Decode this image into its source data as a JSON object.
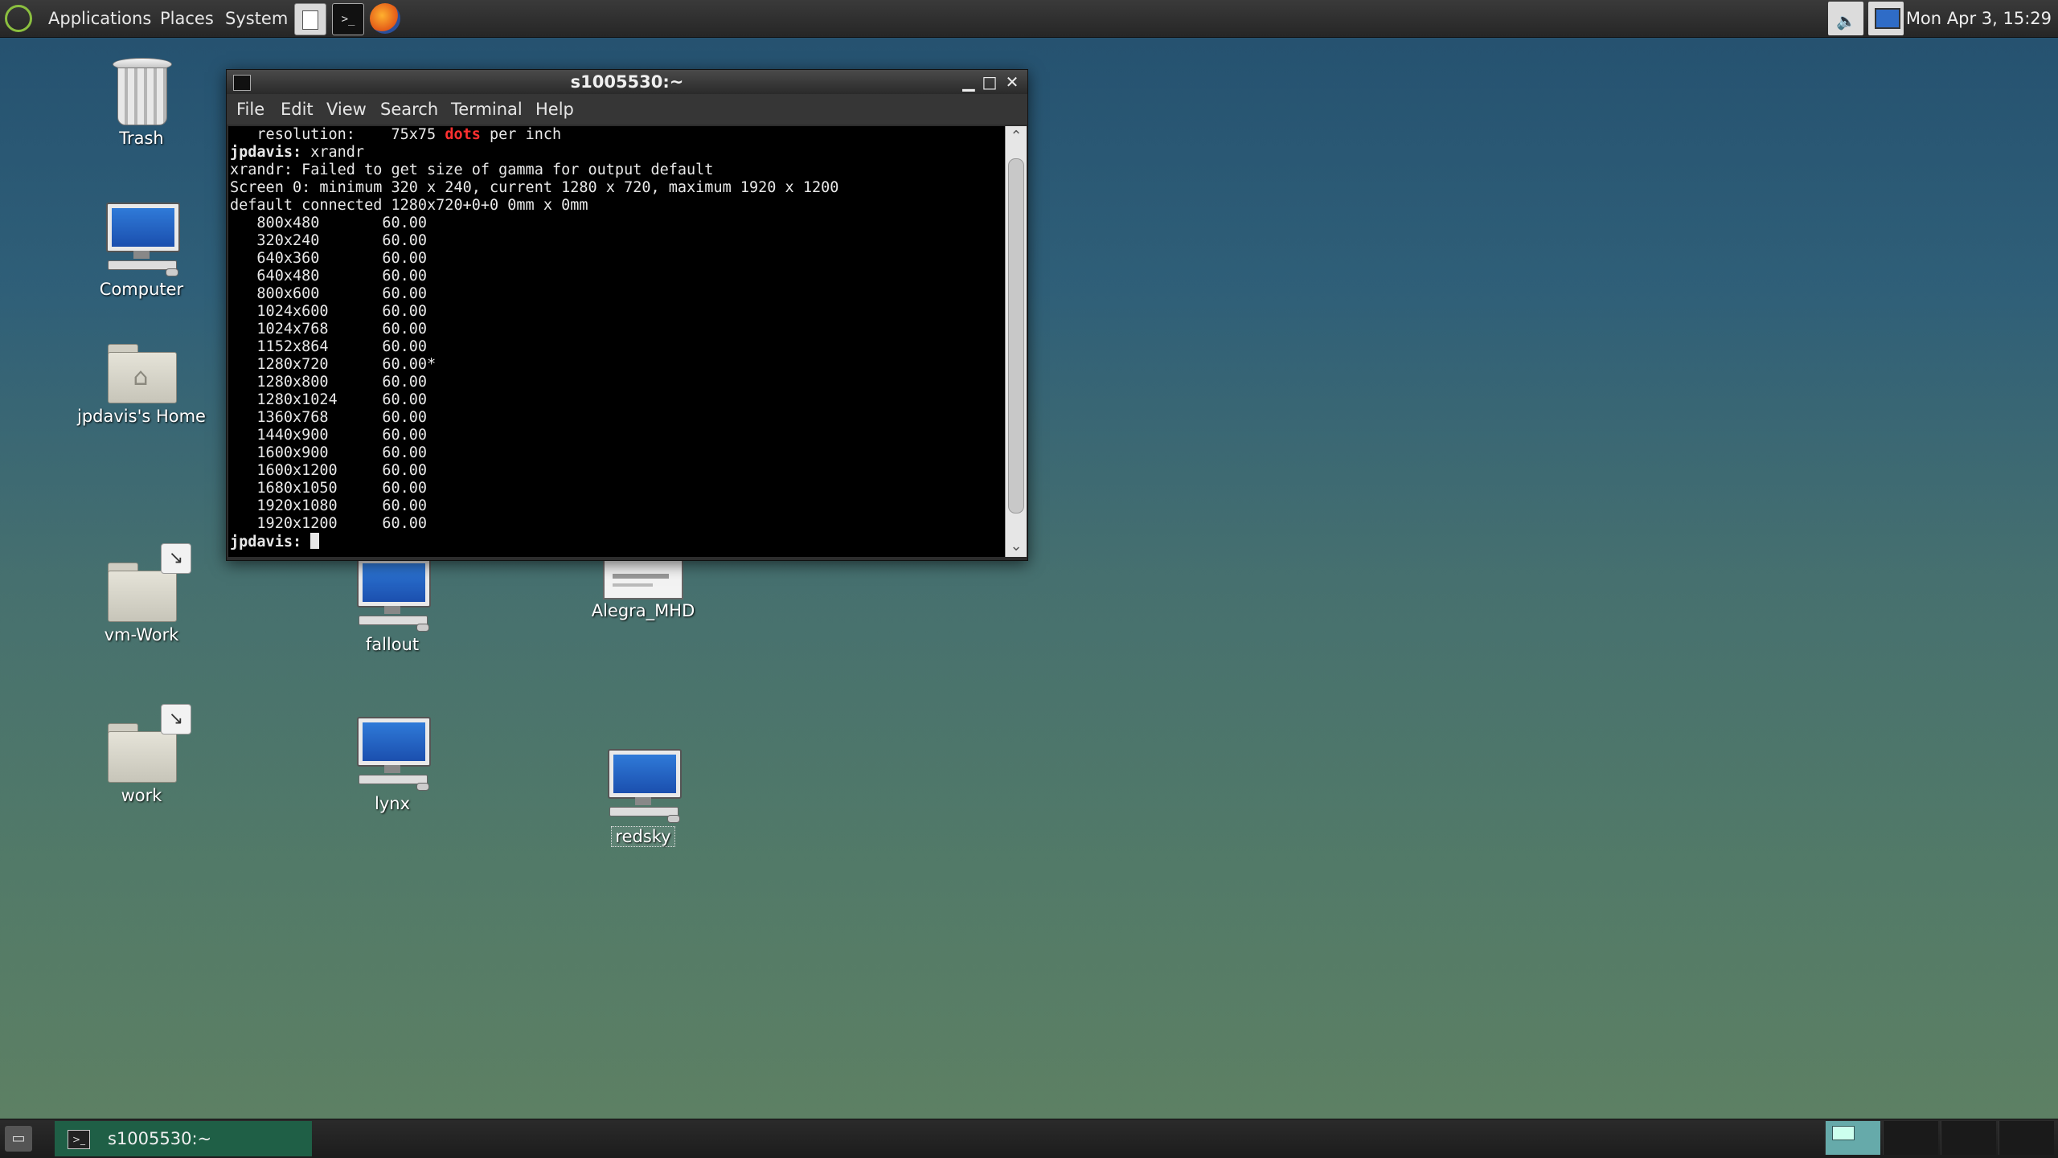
{
  "top_panel": {
    "menus": [
      "Applications",
      "Places",
      "System"
    ],
    "launchers": [
      "text-editor-icon",
      "terminal-icon",
      "firefox-icon"
    ],
    "clock": "Mon Apr  3, 15:29"
  },
  "desktop": {
    "icons": {
      "trash": "Trash",
      "computer": "Computer",
      "home": "jpdavis's Home",
      "vm_work": "vm-Work",
      "work": "work",
      "fallout": "fallout",
      "lynx": "lynx",
      "alegra": "Alegra_MHD",
      "redsky": "redsky"
    }
  },
  "terminal": {
    "title": "s1005530:~",
    "menu": [
      "File",
      "Edit",
      "View",
      "Search",
      "Terminal",
      "Help"
    ],
    "line0_pre": "   resolution:    75x75 ",
    "line0_red": "dots",
    "line0_post": " per inch",
    "prompt": "jpdavis:",
    "command": " xrandr",
    "lines": [
      "xrandr: Failed to get size of gamma for output default",
      "Screen 0: minimum 320 x 240, current 1280 x 720, maximum 1920 x 1200",
      "default connected 1280x720+0+0 0mm x 0mm",
      "   800x480       60.00",
      "   320x240       60.00",
      "   640x360       60.00",
      "   640x480       60.00",
      "   800x600       60.00",
      "   1024x600      60.00",
      "   1024x768      60.00",
      "   1152x864      60.00",
      "   1280x720      60.00*",
      "   1280x800      60.00",
      "   1280x1024     60.00",
      "   1360x768      60.00",
      "   1440x900      60.00",
      "   1600x900      60.00",
      "   1600x1200     60.00",
      "   1680x1050     60.00",
      "   1920x1080     60.00",
      "   1920x1200     60.00"
    ]
  },
  "taskbar": {
    "task_label": "s1005530:~"
  }
}
